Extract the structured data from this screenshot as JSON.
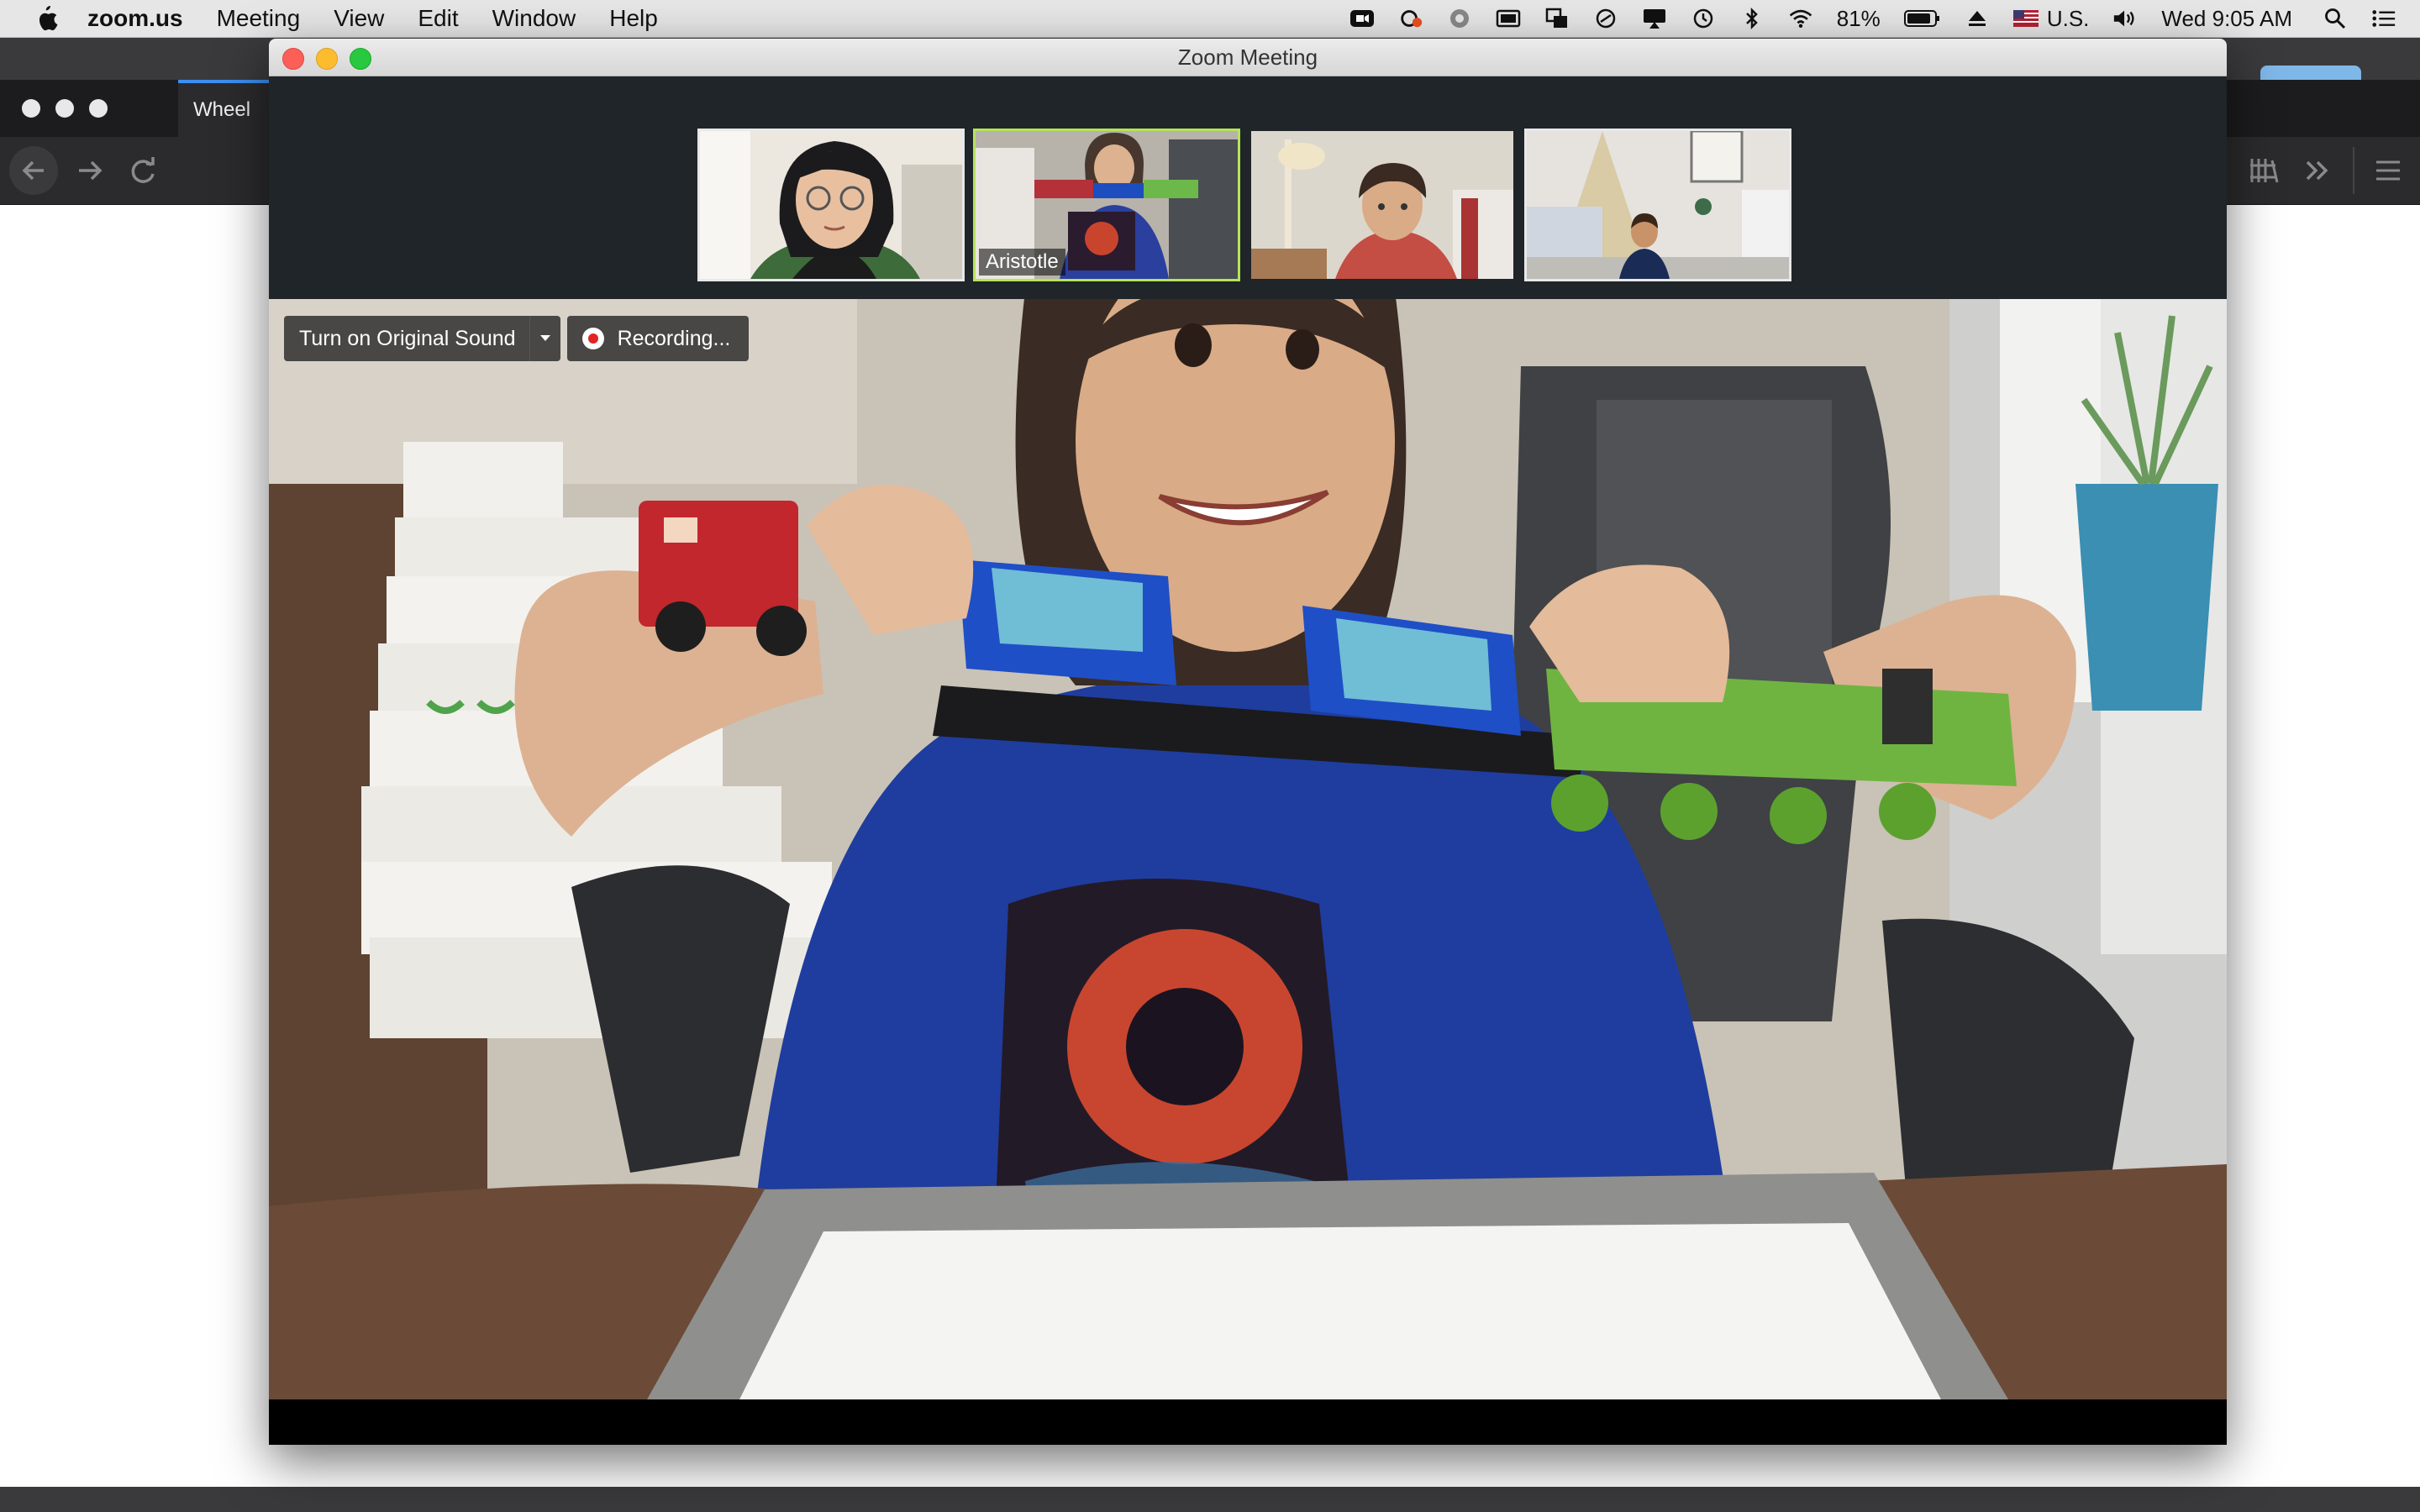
{
  "menubar": {
    "app_name": "zoom.us",
    "items": [
      "Meeting",
      "View",
      "Edit",
      "Window",
      "Help"
    ],
    "battery_percent": "81%",
    "input_source": "U.S.",
    "clock": "Wed 9:05 AM"
  },
  "browser": {
    "tab_label": "Wheel"
  },
  "zoom": {
    "window_title": "Zoom Meeting",
    "active_speaker_name": "Aristotle",
    "original_sound_label": "Turn on Original Sound",
    "recording_label": "Recording..."
  },
  "colors": {
    "active_border": "#b6e35c",
    "recording_dot": "#e02424",
    "tab_accent": "#3d8ef0"
  }
}
